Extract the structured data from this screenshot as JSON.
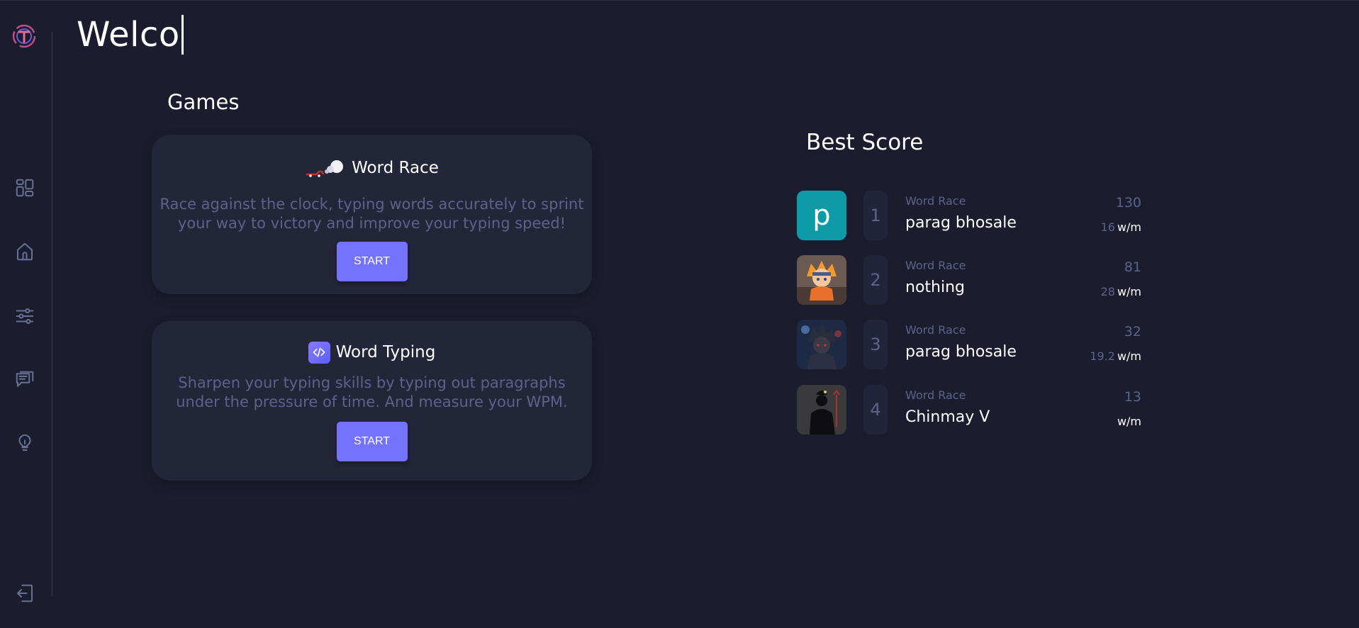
{
  "header": {
    "welcome_text": "Welco"
  },
  "sidebar": {
    "items": [
      {
        "icon": "dashboard-icon"
      },
      {
        "icon": "home-icon"
      },
      {
        "icon": "settings-sliders-icon"
      },
      {
        "icon": "feedback-chat-icon"
      },
      {
        "icon": "idea-bulb-icon"
      },
      {
        "icon": "logout-icon"
      }
    ]
  },
  "games": {
    "title": "Games",
    "cards": [
      {
        "title": "Word Race",
        "description": "Race against the clock, typing words accurately to sprint your way to victory and improve your typing speed!",
        "button": "START",
        "icon": "race-car-icon"
      },
      {
        "title": "Word Typing",
        "description": "Sharpen your typing skills by typing out paragraphs under the pressure of time. And measure your WPM.",
        "button": "START",
        "icon": "code-icon"
      }
    ]
  },
  "best_score": {
    "title": "Best Score",
    "rows": [
      {
        "rank": "1",
        "game": "Word Race",
        "name": "parag bhosale",
        "score": "130",
        "wpm": "16",
        "wpm_unit": "w/m",
        "avatar": "letter",
        "avatar_letter": "p"
      },
      {
        "rank": "2",
        "game": "Word Race",
        "name": "nothing",
        "score": "81",
        "wpm": "28",
        "wpm_unit": "w/m",
        "avatar": "anime-orange"
      },
      {
        "rank": "3",
        "game": "Word Race",
        "name": "parag bhosale",
        "score": "32",
        "wpm": "19.2",
        "wpm_unit": "w/m",
        "avatar": "anime-dark"
      },
      {
        "rank": "4",
        "game": "Word Race",
        "name": "Chinmay V",
        "score": "13",
        "wpm": "",
        "wpm_unit": "w/m",
        "avatar": "silhouette"
      }
    ]
  },
  "colors": {
    "background": "#1b1d2e",
    "card": "#232538",
    "accent": "#7373ff",
    "muted_text": "#5d6288",
    "avatar_teal": "#0e9ba7"
  }
}
